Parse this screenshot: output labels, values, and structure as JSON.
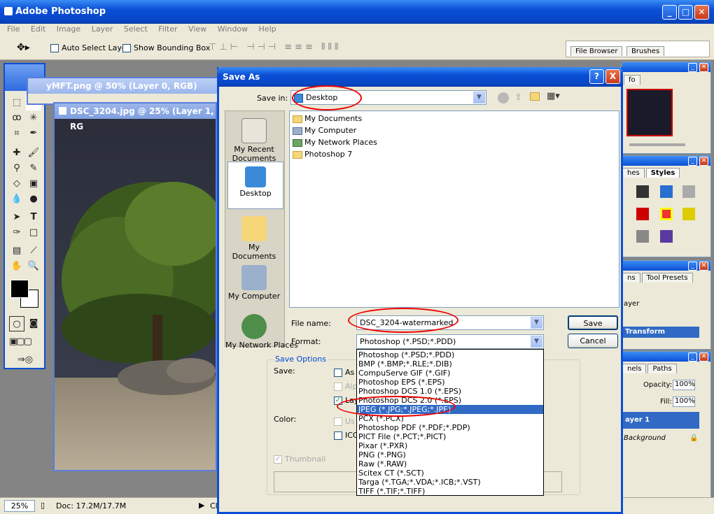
{
  "app": {
    "title": "Adobe Photoshop"
  },
  "menu": [
    "File",
    "Edit",
    "Image",
    "Layer",
    "Select",
    "Filter",
    "View",
    "Window",
    "Help"
  ],
  "options": {
    "auto_select": "Auto Select Layer",
    "bounding_box": "Show Bounding Box"
  },
  "palette_well": {
    "tabs": [
      "File Browser",
      "Brushes"
    ]
  },
  "doc_back": {
    "title": "yMFT.png @ 50% (Layer 0, RGB)"
  },
  "doc_front": {
    "title": "DSC_3204.jpg @ 25% (Layer 1, RG"
  },
  "status": {
    "zoom": "25%",
    "doc": "Doc: 17.2M/17.7M",
    "trailing": "Cl"
  },
  "panels": {
    "navigator": {
      "tab": "fo"
    },
    "styles": {
      "tabs": [
        "hes",
        "Styles"
      ]
    },
    "history": {
      "tabs": [
        "ns",
        "Tool Presets"
      ],
      "items": [
        "ayer",
        "Transform"
      ]
    },
    "layers": {
      "tabs": [
        "nels",
        "Paths"
      ],
      "opacity_label": "Opacity:",
      "opacity": "100%",
      "fill_label": "Fill:",
      "fill": "100%",
      "layers": [
        "ayer 1",
        "Background"
      ]
    }
  },
  "dialog": {
    "title": "Save As",
    "help": "?",
    "close": "X",
    "save_in_label": "Save in:",
    "save_in": "Desktop",
    "places": [
      "My Recent Documents",
      "Desktop",
      "My Documents",
      "My Computer",
      "My Network Places"
    ],
    "files": [
      "My Documents",
      "My Computer",
      "My Network Places",
      "Photoshop 7"
    ],
    "file_name_label": "File name:",
    "file_name": "DSC_3204-watermarked",
    "format_label": "Format:",
    "format": "Photoshop (*.PSD;*.PDD)",
    "save_btn": "Save",
    "cancel_btn": "Cancel",
    "save_options": "Save Options",
    "save_label": "Save:",
    "opt_as": "As",
    "opt_alp": "Alp",
    "opt_lay": "Lay",
    "color_label": "Color:",
    "opt_us": "Us",
    "opt_icc": "ICC",
    "thumbnail": "Thumbnail",
    "formats": [
      "Photoshop (*.PSD;*.PDD)",
      "BMP (*.BMP;*.RLE;*.DIB)",
      "CompuServe GIF (*.GIF)",
      "Photoshop EPS (*.EPS)",
      "Photoshop DCS 1.0 (*.EPS)",
      "Photoshop DCS 2.0 (*.EPS)",
      "JPEG (*.JPG;*.JPEG;*.JPE)",
      "PCX (*.PCX)",
      "Photoshop PDF (*.PDF;*.PDP)",
      "PICT File (*.PCT;*.PICT)",
      "Pixar (*.PXR)",
      "PNG (*.PNG)",
      "Raw (*.RAW)",
      "Scitex CT (*.SCT)",
      "Targa (*.TGA;*.VDA;*.ICB;*.VST)",
      "TIFF (*.TIF;*.TIFF)"
    ],
    "selected_format_index": 6
  }
}
